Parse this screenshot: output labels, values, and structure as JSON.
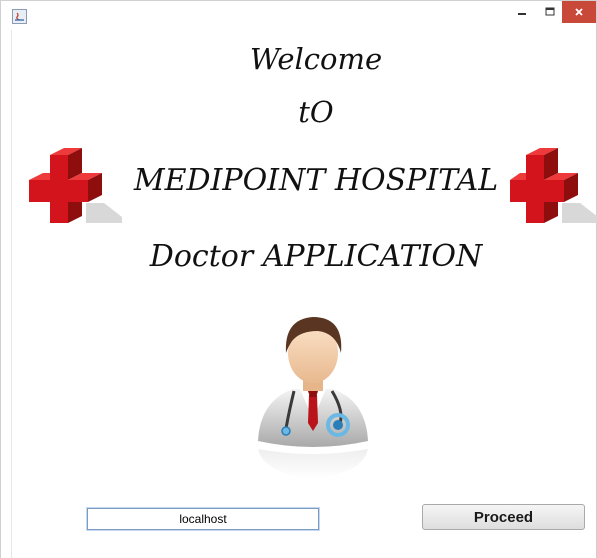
{
  "window": {
    "title": ""
  },
  "headings": {
    "welcome": "Welcome",
    "to": "tO",
    "hospital": "MEDIPOINT HOSPITAL",
    "app": "Doctor APPLICATION"
  },
  "form": {
    "host_value": "localhost",
    "proceed_label": "Proceed"
  },
  "icons": {
    "app": "java-app-icon",
    "minimize": "minimize-icon",
    "maximize": "maximize-icon",
    "close": "close-icon",
    "cross": "medical-cross-icon",
    "doctor": "doctor-avatar-icon"
  },
  "colors": {
    "close_button": "#c8483a",
    "cross_red": "#d3141c",
    "tie_red": "#b8141a",
    "input_border": "#7a9cc3"
  }
}
